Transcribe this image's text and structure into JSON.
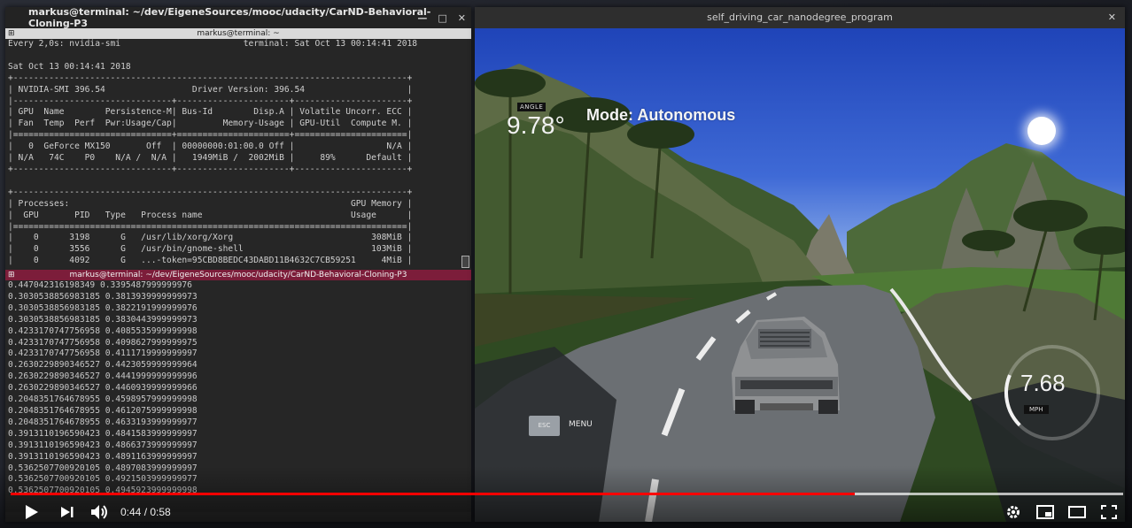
{
  "terminal": {
    "window_title": "markus@terminal: ~/dev/EigeneSources/mooc/udacity/CarND-Behavioral-Cloning-P3",
    "top_pane_title": "markus@terminal: ~",
    "bottom_pane_title": "markus@terminal: ~/dev/EigeneSources/mooc/udacity/CarND-Behavioral-Cloning-P3",
    "top_lines": [
      "Every 2,0s: nvidia-smi                        terminal: Sat Oct 13 00:14:41 2018",
      "",
      "Sat Oct 13 00:14:41 2018",
      "+-----------------------------------------------------------------------------+",
      "| NVIDIA-SMI 396.54                 Driver Version: 396.54                    |",
      "|-------------------------------+----------------------+----------------------+",
      "| GPU  Name        Persistence-M| Bus-Id        Disp.A | Volatile Uncorr. ECC |",
      "| Fan  Temp  Perf  Pwr:Usage/Cap|         Memory-Usage | GPU-Util  Compute M. |",
      "|===============================+======================+======================|",
      "|   0  GeForce MX150       Off  | 00000000:01:00.0 Off |                  N/A |",
      "| N/A   74C    P0    N/A /  N/A |   1949MiB /  2002MiB |     89%      Default |",
      "+-------------------------------+----------------------+----------------------+",
      "",
      "+-----------------------------------------------------------------------------+",
      "| Processes:                                                       GPU Memory |",
      "|  GPU       PID   Type   Process name                             Usage      |",
      "|=============================================================================|",
      "|    0      3198      G   /usr/lib/xorg/Xorg                           308MiB |",
      "|    0      3556      G   /usr/bin/gnome-shell                         103MiB |",
      "|    0      4092      G   ...-token=95CBD8BEDC43DABD11B4632C7CB59251     4MiB |"
    ],
    "bottom_lines": [
      "0.447042316198349 0.3395487999999976",
      "0.3030538856983185 0.3813939999999973",
      "0.3030538856983185 0.3822191999999976",
      "0.3030538856983185 0.3830443999999973",
      "0.4233170747756958 0.4085535999999998",
      "0.4233170747756958 0.4098627999999975",
      "0.4233170747756958 0.4111719999999997",
      "0.2630229890346527 0.4423059999999964",
      "0.2630229890346527 0.4441999999999996",
      "0.2630229890346527 0.4460939999999966",
      "0.2048351764678955 0.4598957999999998",
      "0.2048351764678955 0.4612075999999998",
      "0.2048351764678955 0.4633193999999977",
      "0.3913110196590423 0.4841583999999997",
      "0.3913110196590423 0.4866373999999997",
      "0.3913110196590423 0.4891163999999997",
      "0.5362507700920105 0.4897083999999997",
      "0.5362507700920105 0.4921503999999977",
      "0.5362507700920105 0.4945923999999998"
    ]
  },
  "simulator": {
    "window_title": "self_driving_car_nanodegree_program",
    "angle_label": "ANGLE",
    "angle_value": "9.78°",
    "mode_text": "Mode: Autonomous",
    "speed_value": "7.68",
    "speed_unit": "MPH",
    "speed_fraction": 0.25,
    "esc_label": "ESC",
    "menu_label": "MENU"
  },
  "player": {
    "time": "0:44 / 0:58",
    "played_fraction": 0.7586,
    "buffered_fraction": 1.0,
    "icons": [
      "play-icon",
      "next-icon",
      "volume-icon",
      "settings-icon",
      "miniplayer-icon",
      "theater-icon",
      "fullscreen-icon"
    ],
    "accent_color": "#ff0000"
  }
}
